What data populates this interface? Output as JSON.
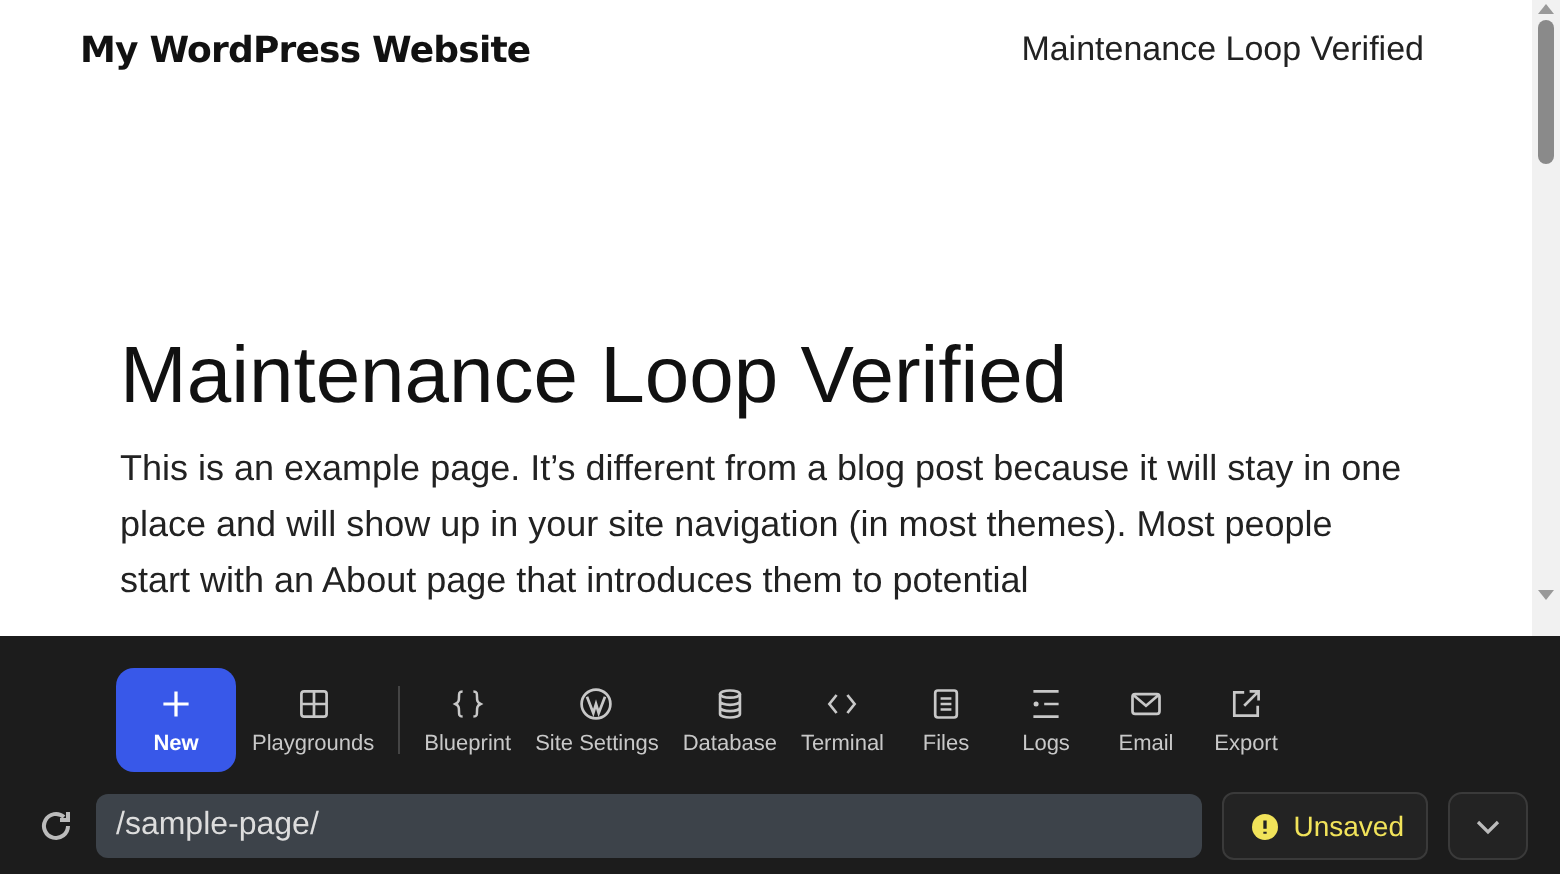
{
  "site": {
    "title": "My WordPress Website",
    "nav_link": "Maintenance Loop Verified"
  },
  "page": {
    "heading": "Maintenance Loop Verified",
    "body": "This is an example page. It’s different from a blog post because it will stay in one place and will show up in your site navigation (in most themes). Most people start with an About page that introduces them to potential"
  },
  "toolbar": [
    {
      "kind": "primary",
      "label": "New"
    },
    {
      "kind": "tool",
      "label": "Playgrounds"
    },
    {
      "kind": "separator"
    },
    {
      "kind": "tool",
      "label": "Blueprint"
    },
    {
      "kind": "tool",
      "label": "Site Settings"
    },
    {
      "kind": "tool",
      "label": "Database"
    },
    {
      "kind": "tool",
      "label": "Terminal"
    },
    {
      "kind": "tool",
      "label": "Files"
    },
    {
      "kind": "tool",
      "label": "Logs"
    },
    {
      "kind": "tool",
      "label": "Email"
    },
    {
      "kind": "tool",
      "label": "Export"
    }
  ],
  "address_bar": {
    "value": "/sample-page/"
  },
  "status": {
    "label": "Unsaved"
  }
}
